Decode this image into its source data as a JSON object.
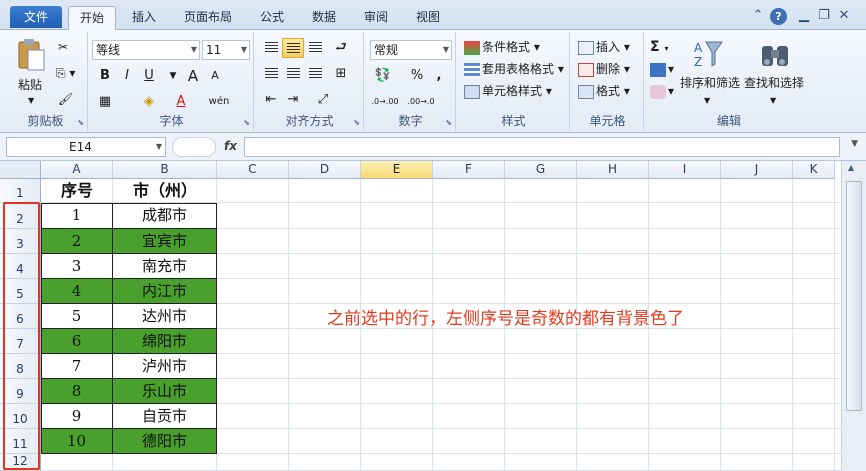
{
  "tabs": [
    "文件",
    "开始",
    "插入",
    "页面布局",
    "公式",
    "数据",
    "审阅",
    "视图"
  ],
  "ribbon": {
    "clipboard": {
      "label": "剪贴板",
      "paste": "粘贴"
    },
    "font": {
      "label": "字体",
      "name": "等线",
      "size": "11",
      "bold": "B",
      "italic": "I",
      "underline": "U",
      "grow": "A",
      "shrink": "A",
      "wen": "wén"
    },
    "align": {
      "label": "对齐方式"
    },
    "number": {
      "label": "数字",
      "format": "常规",
      "percent": "%",
      "comma": ",",
      "inc": ".0→.00",
      "dec": ".00→.0"
    },
    "styles": {
      "label": "样式",
      "cond": "条件格式",
      "table": "套用表格格式",
      "cell": "单元格样式"
    },
    "cells": {
      "label": "单元格",
      "insert": "插入",
      "delete": "删除",
      "format": "格式"
    },
    "editing": {
      "label": "编辑",
      "sort": "排序和筛选",
      "find": "查找和选择",
      "sigma": "Σ"
    }
  },
  "formula_bar": {
    "name_box": "E14",
    "fx": "fx",
    "content": ""
  },
  "columns": [
    "A",
    "B",
    "C",
    "D",
    "E",
    "F",
    "G",
    "H",
    "I",
    "J",
    "K"
  ],
  "selected_column": "E",
  "rows": [
    "1",
    "2",
    "3",
    "4",
    "5",
    "6",
    "7",
    "8",
    "9",
    "10",
    "11",
    "12"
  ],
  "table": {
    "headers": [
      "序号",
      "市（州）"
    ],
    "data": [
      {
        "no": "1",
        "city": "成都市",
        "highlight": false
      },
      {
        "no": "2",
        "city": "宜宾市",
        "highlight": true
      },
      {
        "no": "3",
        "city": "南充市",
        "highlight": false
      },
      {
        "no": "4",
        "city": "内江市",
        "highlight": true
      },
      {
        "no": "5",
        "city": "达州市",
        "highlight": false
      },
      {
        "no": "6",
        "city": "绵阳市",
        "highlight": true
      },
      {
        "no": "7",
        "city": "泸州市",
        "highlight": false
      },
      {
        "no": "8",
        "city": "乐山市",
        "highlight": true
      },
      {
        "no": "9",
        "city": "自贡市",
        "highlight": false
      },
      {
        "no": "10",
        "city": "德阳市",
        "highlight": true
      }
    ]
  },
  "annotation": "之前选中的行，左侧序号是奇数的都有背景色了",
  "colors": {
    "highlight": "#4aa02c",
    "annotation": "#e33b1f"
  }
}
